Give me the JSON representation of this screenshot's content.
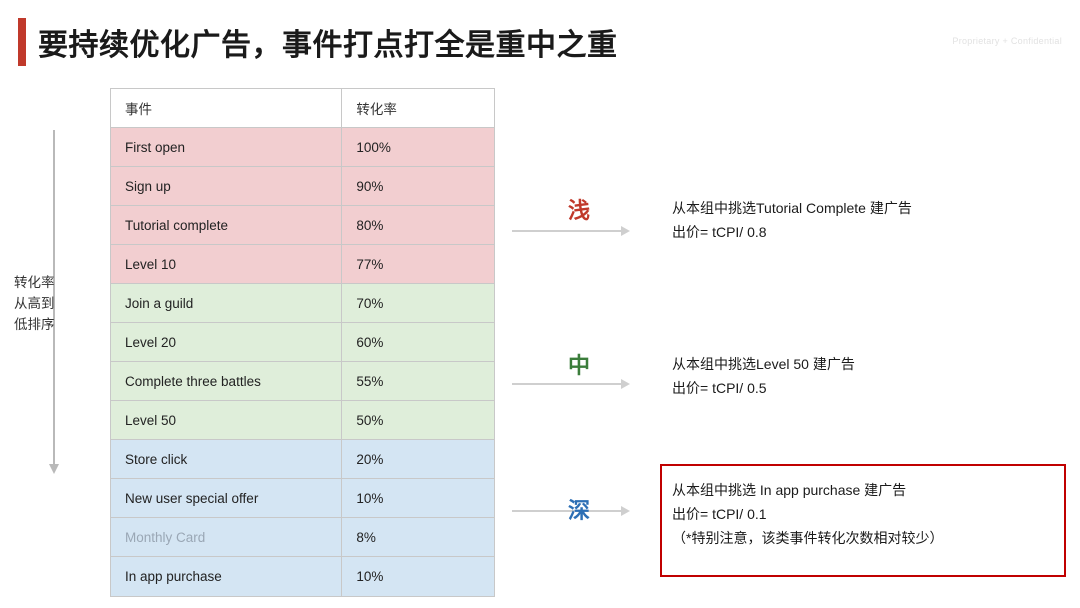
{
  "slide": {
    "title": "要持续优化广告，事件打点打全是重中之重",
    "confidential": "Proprietary + Confidential",
    "axis_label": "转化率\n从高到\n低排序"
  },
  "table": {
    "headers": [
      "事件",
      "转化率"
    ],
    "rows": [
      {
        "event": "First open",
        "rate": "100%",
        "band": "red"
      },
      {
        "event": "Sign up",
        "rate": "90%",
        "band": "red"
      },
      {
        "event": "Tutorial complete",
        "rate": "80%",
        "band": "red"
      },
      {
        "event": "Level 10",
        "rate": "77%",
        "band": "red"
      },
      {
        "event": "Join a guild",
        "rate": "70%",
        "band": "green"
      },
      {
        "event": "Level 20",
        "rate": "60%",
        "band": "green"
      },
      {
        "event": "Complete three battles",
        "rate": "55%",
        "band": "green"
      },
      {
        "event": "Level 50",
        "rate": "50%",
        "band": "green"
      },
      {
        "event": "Store click",
        "rate": "20%",
        "band": "blue"
      },
      {
        "event": "New user special offer",
        "rate": "10%",
        "band": "blue"
      },
      {
        "event": "Monthly Card",
        "rate": "8%",
        "band": "blue",
        "muted": true
      },
      {
        "event": "In app purchase",
        "rate": "10%",
        "band": "blue"
      }
    ]
  },
  "groups": [
    {
      "depth_label": "浅",
      "depth_color": "#c0392b",
      "line1": "从本组中挑选Tutorial Complete 建广告",
      "line2": "出价= tCPI/ 0.8",
      "line3": ""
    },
    {
      "depth_label": "中",
      "depth_color": "#3b7d3b",
      "line1": "从本组中挑选Level 50 建广告",
      "line2": "出价= tCPI/ 0.5",
      "line3": ""
    },
    {
      "depth_label": "深",
      "depth_color": "#2d6fb5",
      "line1": "从本组中挑选 In app purchase 建广告",
      "line2": "出价= tCPI/ 0.1",
      "line3": "（*特别注意，该类事件转化次数相对较少）"
    }
  ],
  "colors": {
    "accent_red": "#c0392b",
    "band_red": "#f2ced0",
    "band_green": "#dfeeda",
    "band_blue": "#d4e5f3",
    "highlight_box": "#c00000"
  }
}
